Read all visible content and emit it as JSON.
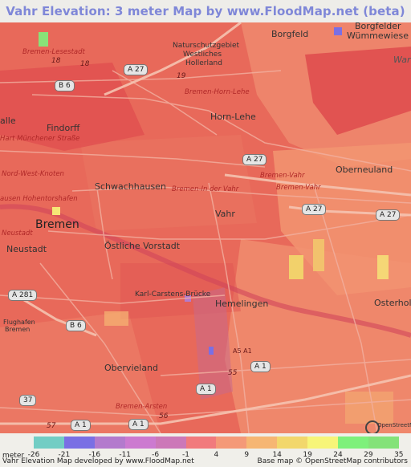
{
  "title": "Vahr Elevation: 3 meter Map by www.FloodMap.net (beta)",
  "map": {
    "places": [
      {
        "id": "borgfeld",
        "text": "Borgfeld"
      },
      {
        "id": "borgfelder",
        "text": "Borgfelder"
      },
      {
        "id": "wummewiese",
        "text": "Wümmewiese"
      },
      {
        "id": "naturschutz1",
        "text": "Naturschutzgebiet"
      },
      {
        "id": "naturschutz2",
        "text": "Westliches"
      },
      {
        "id": "naturschutz3",
        "text": "Hollerland"
      },
      {
        "id": "horn_lehe",
        "text": "Horn-Lehe"
      },
      {
        "id": "findorff",
        "text": "Findorff"
      },
      {
        "id": "schwachhausen",
        "text": "Schwachhausen"
      },
      {
        "id": "oberneuland",
        "text": "Oberneuland"
      },
      {
        "id": "vahr",
        "text": "Vahr"
      },
      {
        "id": "bremen",
        "text": "Bremen"
      },
      {
        "id": "neustadt",
        "text": "Neustadt"
      },
      {
        "id": "oestliche_vorstadt",
        "text": "Östliche Vorstadt"
      },
      {
        "id": "karl_carstens",
        "text": "Karl-Carstens-Brücke"
      },
      {
        "id": "hemelingen",
        "text": "Hemelingen"
      },
      {
        "id": "osterholz",
        "text": "Osterholz"
      },
      {
        "id": "obervieland",
        "text": "Obervieland"
      },
      {
        "id": "alle",
        "text": "alle"
      },
      {
        "id": "flughafen",
        "text": "Flughafen"
      },
      {
        "id": "bremen_small",
        "text": "Bremen"
      },
      {
        "id": "war",
        "text": "War"
      }
    ],
    "streets": [
      {
        "id": "bremen_lesestadt",
        "text": "Bremen-Lesestadt"
      },
      {
        "id": "bremen_horn_lehe",
        "text": "Bremen-Horn-Lehe"
      },
      {
        "id": "munchener_strasse",
        "text": "Hart Münchener Straße"
      },
      {
        "id": "nord_west_knoten",
        "text": "Nord-West-Knoten"
      },
      {
        "id": "hohentorshafen",
        "text": "ausen Hohentorshafen"
      },
      {
        "id": "bremen_in_der_vahr",
        "text": "Bremen-In der Vahr"
      },
      {
        "id": "bremen_vahr1",
        "text": "Bremen-Vahr"
      },
      {
        "id": "bremen_vahr2",
        "text": "Bremen-Vahr"
      },
      {
        "id": "neustadt_street",
        "text": "Neustadt"
      },
      {
        "id": "bremen_arsten",
        "text": "Bremen-Arsten"
      }
    ],
    "shields": [
      {
        "id": "a27_top",
        "text": "A 27"
      },
      {
        "id": "b6_top",
        "text": "B 6"
      },
      {
        "id": "a27_mid",
        "text": "A 27"
      },
      {
        "id": "a27_vahr",
        "text": "A 27"
      },
      {
        "id": "a27_right",
        "text": "A 27"
      },
      {
        "id": "a281",
        "text": "A 281"
      },
      {
        "id": "b6_bottom",
        "text": "B 6"
      },
      {
        "id": "a1_mid",
        "text": "A 1"
      },
      {
        "id": "a1_low",
        "text": "A 1"
      },
      {
        "id": "a1_bottom",
        "text": "A 1"
      },
      {
        "id": "a1_bottom2",
        "text": "A 1"
      },
      {
        "id": "a1_text",
        "text": "A5 A1"
      },
      {
        "id": "b37",
        "text": "37"
      }
    ],
    "route_numbers": [
      {
        "id": "r18a",
        "text": "18"
      },
      {
        "id": "r18b",
        "text": "18"
      },
      {
        "id": "r19",
        "text": "19"
      },
      {
        "id": "r55",
        "text": "55"
      },
      {
        "id": "r56",
        "text": "56"
      },
      {
        "id": "r57",
        "text": "57"
      }
    ],
    "osm_badge": "OpenStreetMap"
  },
  "legend": {
    "unit_label": "meter",
    "ticks": [
      "-26",
      "-21",
      "-16",
      "-11",
      "-6",
      "-1",
      "4",
      "9",
      "14",
      "19",
      "24",
      "29",
      "35"
    ],
    "colors": [
      "#72cdc4",
      "#7a6fe4",
      "#b37acd",
      "#cc7ad0",
      "#cc78b8",
      "#f17a7d",
      "#f49978",
      "#f6b673",
      "#f2d76c",
      "#f7f579",
      "#7ef07b",
      "#84e279"
    ],
    "footer_left": "Vahr Elevation Map developed by www.FloodMap.net",
    "footer_right": "Base map © OpenStreetMap contributors"
  }
}
